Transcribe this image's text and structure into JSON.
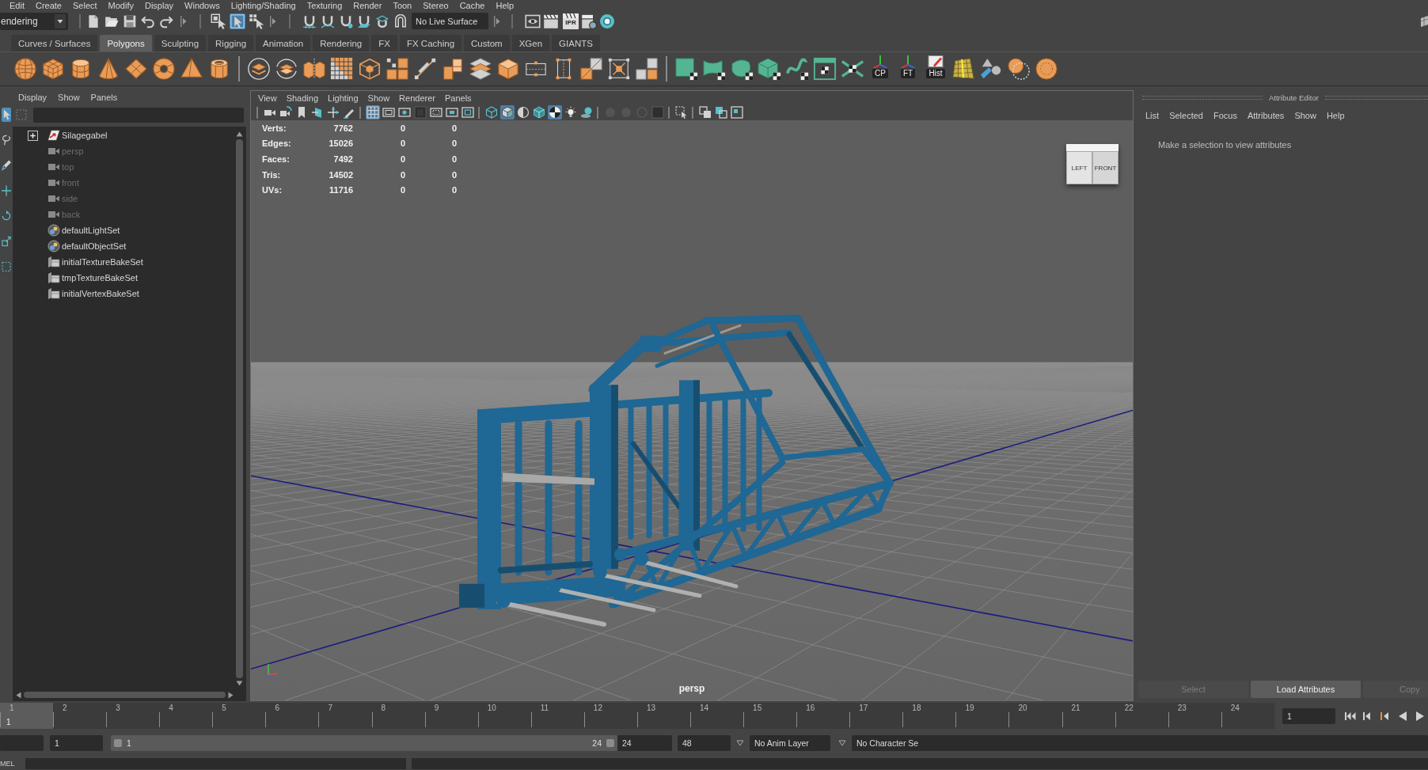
{
  "menu_bar": {
    "items": [
      "Edit",
      "Create",
      "Select",
      "Modify",
      "Display",
      "Windows",
      "Lighting/Shading",
      "Texturing",
      "Render",
      "Toon",
      "Stereo",
      "Cache",
      "Help"
    ]
  },
  "status_line": {
    "menu_set": "endering",
    "selection_modes": [
      {
        "selected": false
      },
      {
        "selected": true
      },
      {
        "selected": false
      }
    ],
    "live_surface": "No Live Surface",
    "ipr_label": "IPR"
  },
  "shelf": {
    "tabs": [
      {
        "label": "Curves / Surfaces",
        "selected": false
      },
      {
        "label": "Polygons",
        "selected": true
      },
      {
        "label": "Sculpting",
        "selected": false
      },
      {
        "label": "Rigging",
        "selected": false
      },
      {
        "label": "Animation",
        "selected": false
      },
      {
        "label": "Rendering",
        "selected": false
      },
      {
        "label": "FX",
        "selected": false
      },
      {
        "label": "FX Caching",
        "selected": false
      },
      {
        "label": "Custom",
        "selected": false
      },
      {
        "label": "XGen",
        "selected": false
      },
      {
        "label": "GIANTS",
        "selected": false
      }
    ],
    "labeled_tools": [
      {
        "label": "CP",
        "kind": "axes"
      },
      {
        "label": "FT",
        "kind": "axes"
      },
      {
        "label": "Hist",
        "kind": "note"
      }
    ]
  },
  "toolbox": {
    "tools": [
      {
        "selected": true
      },
      {
        "selected": false
      },
      {
        "selected": false
      },
      {
        "selected": false
      },
      {
        "selected": false
      },
      {
        "selected": false
      },
      {
        "selected": false
      }
    ]
  },
  "outliner": {
    "menu": [
      "Display",
      "Show",
      "Panels"
    ],
    "items": [
      {
        "name": "Silagegabel",
        "kind": "transform",
        "expanded": false,
        "hidden": false
      },
      {
        "name": "persp",
        "kind": "camera",
        "hidden": true
      },
      {
        "name": "top",
        "kind": "camera",
        "hidden": true
      },
      {
        "name": "front",
        "kind": "camera",
        "hidden": true
      },
      {
        "name": "side",
        "kind": "camera",
        "hidden": true
      },
      {
        "name": "back",
        "kind": "camera",
        "hidden": true
      },
      {
        "name": "defaultLightSet",
        "kind": "set",
        "hidden": false
      },
      {
        "name": "defaultObjectSet",
        "kind": "set",
        "hidden": false
      },
      {
        "name": "initialTextureBakeSet",
        "kind": "bake_set",
        "hidden": false
      },
      {
        "name": "tmpTextureBakeSet",
        "kind": "bake_set",
        "hidden": false
      },
      {
        "name": "initialVertexBakeSet",
        "kind": "bake_set",
        "hidden": false
      }
    ]
  },
  "viewport": {
    "menu": [
      "View",
      "Shading",
      "Lighting",
      "Show",
      "Renderer",
      "Panels"
    ],
    "toolbar": [
      {
        "selected": false
      },
      {
        "selected": false
      },
      {
        "selected": false
      },
      {
        "selected": false
      },
      {
        "selected": false
      },
      {
        "selected": false
      },
      {
        "selected": true
      },
      {
        "selected": false
      },
      {
        "selected": false
      },
      {
        "selected": false
      },
      {
        "selected": false
      },
      {
        "selected": false
      },
      {
        "selected": false
      },
      {
        "selected": false
      },
      {
        "selected": true
      },
      {
        "selected": false
      },
      {
        "selected": false
      },
      {
        "selected": true
      },
      {
        "selected": false
      },
      {
        "selected": false
      },
      {
        "selected": false
      },
      {
        "selected": false
      },
      {
        "selected": false
      },
      {
        "selected": false
      },
      {
        "selected": false
      },
      {
        "selected": false
      },
      {
        "selected": false
      },
      {
        "selected": false
      }
    ],
    "hud": [
      {
        "label": "Verts:",
        "values": [
          "7762",
          "0",
          "0"
        ]
      },
      {
        "label": "Edges:",
        "values": [
          "15026",
          "0",
          "0"
        ]
      },
      {
        "label": "Faces:",
        "values": [
          "7492",
          "0",
          "0"
        ]
      },
      {
        "label": "Tris:",
        "values": [
          "14502",
          "0",
          "0"
        ]
      },
      {
        "label": "UVs:",
        "values": [
          "11716",
          "0",
          "0"
        ]
      }
    ],
    "view_cube": {
      "faces": [
        "LEFT",
        "FRONT"
      ]
    },
    "camera": "persp"
  },
  "attribute_editor": {
    "title": "Attribute Editor",
    "menu": [
      "List",
      "Selected",
      "Focus",
      "Attributes",
      "Show",
      "Help"
    ],
    "message": "Make a selection to view attributes",
    "buttons": [
      {
        "label": "Select",
        "disabled": true
      },
      {
        "label": "Load Attributes",
        "disabled": false
      },
      {
        "label": "Copy",
        "disabled": true
      }
    ]
  },
  "time_slider": {
    "frames": [
      "1",
      "2",
      "3",
      "4",
      "5",
      "6",
      "7",
      "8",
      "9",
      "10",
      "11",
      "12",
      "13",
      "14",
      "15",
      "16",
      "17",
      "18",
      "19",
      "20",
      "21",
      "22",
      "23",
      "24"
    ],
    "level": 0,
    "playhead_frame": "1",
    "current_frame": "1"
  },
  "range_slider": {
    "start": "1",
    "level": 1,
    "range_start": "1",
    "range_end": "24",
    "end": "24",
    "animation_end": "48",
    "anim_layer": "No Anim Layer",
    "character_set": "No Character Se"
  },
  "command_line": {
    "language": "MEL"
  }
}
